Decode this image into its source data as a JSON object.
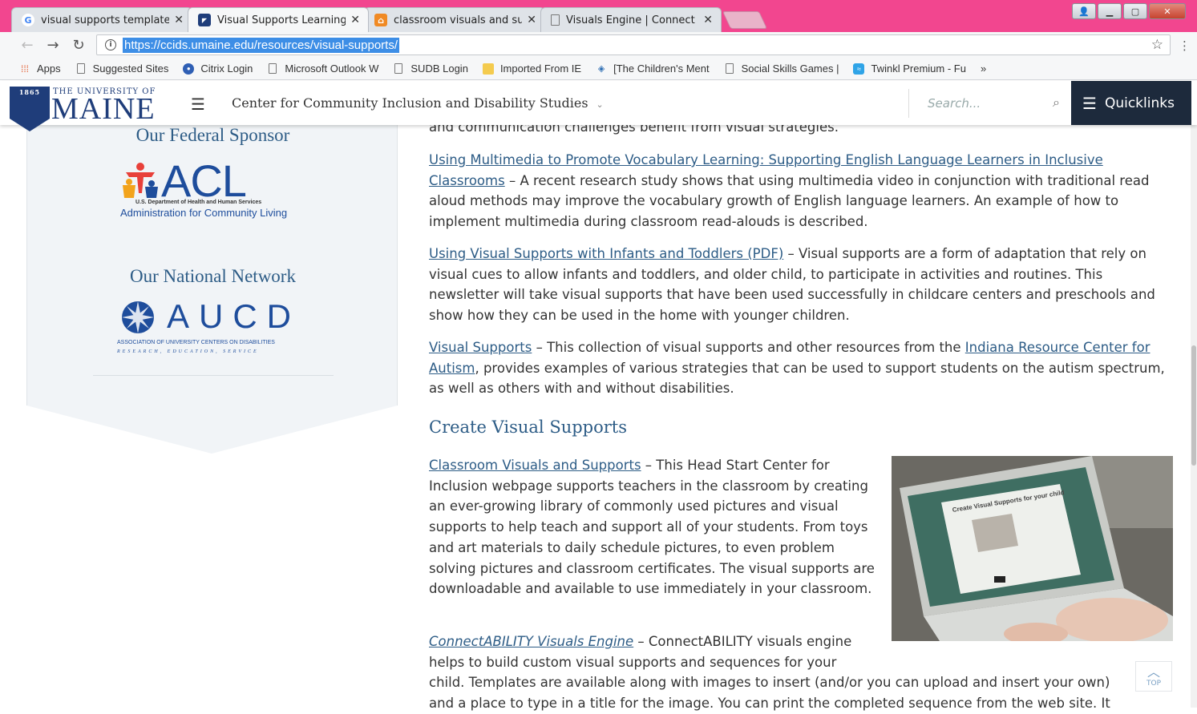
{
  "browser": {
    "tabs": [
      {
        "title": "visual supports template",
        "favicon": "google-icon",
        "active": false
      },
      {
        "title": "Visual Supports Learning",
        "favicon": "umaine-icon",
        "active": true
      },
      {
        "title": "classroom visuals and sup",
        "favicon": "home-icon",
        "active": false
      },
      {
        "title": "Visuals Engine | Connect",
        "favicon": "page-icon",
        "active": false
      }
    ],
    "url": "https://ccids.umaine.edu/resources/visual-supports/",
    "bookmarks": [
      {
        "label": "Apps",
        "icon": "apps-grid-icon"
      },
      {
        "label": "Suggested Sites",
        "icon": "page-icon"
      },
      {
        "label": "Citrix Login",
        "icon": "citrix-icon"
      },
      {
        "label": "Microsoft Outlook W",
        "icon": "page-icon"
      },
      {
        "label": "SUDB Login",
        "icon": "page-icon"
      },
      {
        "label": "Imported From IE",
        "icon": "folder-icon"
      },
      {
        "label": "[The Children's Ment",
        "icon": "globe-icon"
      },
      {
        "label": "Social Skills Games | ",
        "icon": "page-icon"
      },
      {
        "label": "Twinkl Premium - Fu",
        "icon": "twinkl-icon"
      }
    ],
    "more_bookmarks": "»"
  },
  "site": {
    "logo_year": "1865",
    "logo_university": "THE UNIVERSITY OF",
    "logo_name": "MAINE",
    "title": "Center for Community Inclusion and Disability Studies",
    "search_placeholder": "Search...",
    "quicklinks": "Quicklinks"
  },
  "sidebar": {
    "federal_heading": "Our Federal Sponsor",
    "acl_big": "ACL",
    "acl_small1": "U.S. Department of Health and Human Services",
    "acl_small2": "Administration for Community Living",
    "national_heading": "Our National Network",
    "aucd_big": "AUCD",
    "aucd_small1": "ASSOCIATION OF UNIVERSITY CENTERS ON DISABILITIES",
    "aucd_small2": "RESEARCH, EDUCATION, SERVICE"
  },
  "main": {
    "cut_text": "and communication challenges benefit from visual strategies.",
    "item1_link": "Using Multimedia to Promote Vocabulary Learning: Supporting English Language Learners in Inclusive Classrooms",
    "item1_text": " – A recent research study shows that using multimedia video in conjunction with traditional read aloud methods may improve the vocabulary growth of English language learners. An example of how to implement multimedia during classroom read-alouds is described.",
    "item2_link": "Using Visual Supports with Infants and Toddlers (PDF)",
    "item2_text": " – Visual supports are a form of adaptation that rely on visual cues to allow infants and toddlers, and older child, to participate in activities and routines. This newsletter will take visual supports that have been used successfully in childcare centers and preschools and show how they can be used in the home with younger children.",
    "item3_link": "Visual Supports",
    "item3_mid": " – This collection of visual supports and other resources from the ",
    "item3_link2": "Indiana Resource Center for Autism",
    "item3_text": ", provides examples of various strategies that can be used to support students on the autism spectrum, as well as others with and without disabilities.",
    "section_heading": "Create Visual Supports",
    "item4_link": "Classroom Visuals and Supports",
    "item4_text": " – This Head Start Center for Inclusion webpage supports teachers in the classroom by creating an ever-growing library of commonly used pictures and visual supports to help teach and support all of your students. From toys and art materials to daily schedule pictures, to even problem solving pictures and classroom certificates. The visual supports are downloadable and available to use immediately in your classroom.",
    "item5_link": "ConnectABILITY Visuals Engine",
    "item5_text": " – ConnectABILITY visuals engine helps to build custom visual supports and sequences for your",
    "item5_cont": "child. Templates are available along with images to insert (and/or you can upload and insert your own)",
    "item5_cont2": "and a place to type in a title for the image. You can print the completed sequence from the web site. It",
    "photo_screen_title": "Create Visual Supports for your child",
    "to_top": "TOP"
  }
}
